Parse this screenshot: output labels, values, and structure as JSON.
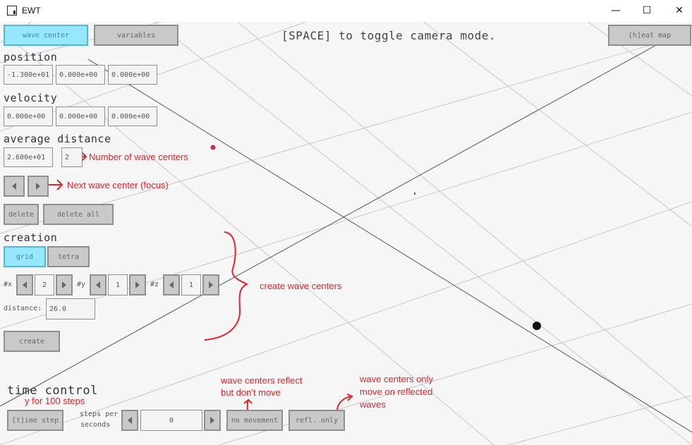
{
  "window": {
    "title": "EWT",
    "minimize": "—",
    "maximize": "☐",
    "close": "✕"
  },
  "top_bar": {
    "wave_center_tab": "wave center",
    "variables_tab": "variables",
    "hint": "[SPACE] to toggle camera mode.",
    "heat_map_button": "[h]eat map"
  },
  "position": {
    "label": "position",
    "x": "-1.300e+01",
    "y": "0.000e+00",
    "z": "0.000e+00"
  },
  "velocity": {
    "label": "velocity",
    "x": "0.000e+00",
    "y": "0.000e+00",
    "z": "0.000e+00"
  },
  "average_distance": {
    "label": "average distance",
    "value": "2.600e+01",
    "count": "2"
  },
  "actions": {
    "delete": "delete",
    "delete_all": "delete all"
  },
  "creation": {
    "label": "creation",
    "grid": "grid",
    "tetra": "tetra",
    "x_label": "#x",
    "x_value": "2",
    "y_label": "#y",
    "y_value": "1",
    "z_label": "#z",
    "z_value": "1",
    "distance_label": "distance:",
    "distance_value": "26.0",
    "create": "create"
  },
  "time_control": {
    "label": "time control",
    "time_step": "[t]ime step",
    "steps_per_label_1": "steps per",
    "steps_per_label_2": "seconds",
    "steps_value": "0",
    "no_movement": "no movement",
    "refl_only": "refl. only"
  },
  "annotations": {
    "num_wave_centers": "Number of wave centers",
    "next_wave_center": "Next wave center (focus)",
    "create_wave_centers": "create wave centers",
    "y_for_100": "y for 100 steps",
    "reflect_1": "wave centers reflect",
    "reflect_2": "but don't move",
    "only_1": "wave centers only",
    "only_2": "move on reflected",
    "only_3": "waves"
  },
  "colors": {
    "active_button": "#97e8ff",
    "annotation": "#e0272b"
  }
}
